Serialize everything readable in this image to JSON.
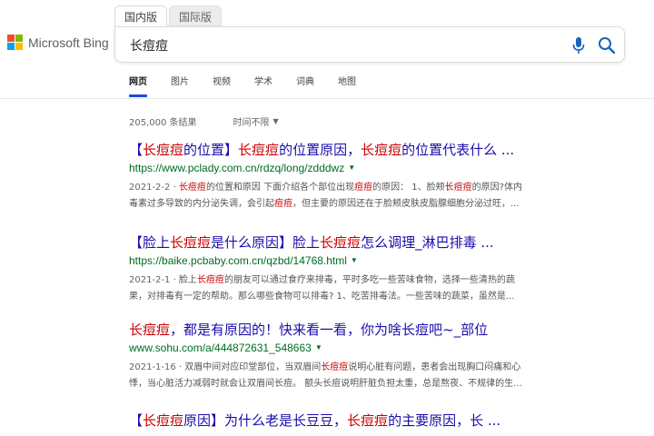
{
  "brand": {
    "logo_text": "Microsoft Bing",
    "logo_colors": [
      "#f25022",
      "#7fba00",
      "#00a4ef",
      "#ffb900"
    ]
  },
  "scope_tabs": [
    {
      "label": "国内版",
      "active": true
    },
    {
      "label": "国际版",
      "active": false
    }
  ],
  "search": {
    "query": "长痘痘",
    "mic_icon": "mic-icon",
    "search_icon": "search-icon"
  },
  "nav": {
    "items": [
      {
        "label": "网页",
        "active": true
      },
      {
        "label": "图片",
        "active": false
      },
      {
        "label": "视频",
        "active": false
      },
      {
        "label": "学术",
        "active": false
      },
      {
        "label": "词典",
        "active": false
      },
      {
        "label": "地图",
        "active": false
      }
    ]
  },
  "meta": {
    "result_count": "205,000 条结果",
    "time_filter": "时间不限"
  },
  "colors": {
    "link": "#1a0dab",
    "highlight": "#c00000",
    "url": "#006d21",
    "nav_active": "#174ae4"
  },
  "results": [
    {
      "title": {
        "p1": "【",
        "h1": "长痘痘",
        "p2": "的位置】",
        "h2": "长痘痘",
        "p3": "的位置原因，",
        "h3": "长痘痘",
        "p4": "的位置代表什么 ..."
      },
      "url": "https://www.pclady.com.cn/rdzq/long/zdddwz",
      "snippet": {
        "date": "2021-2-2",
        "l1a": " · ",
        "l1h1": "长痘痘",
        "l1b": "的位置和原因 下面介绍各个部位出现",
        "l1h2": "痘痘",
        "l1c": "的原因： 1、脸颊",
        "l1h3": "长痘痘",
        "l1d": "的原因?体内",
        "l2a": "毒素过多导致的内分泌失调，会引起",
        "l2h1": "痘痘",
        "l2b": "，但主要的原因还在于脸颊皮肤皮脂腺细胞分泌过旺，..."
      }
    },
    {
      "title": {
        "p1": "【脸上",
        "h1": "长痘痘",
        "p2": "是什么原因】脸上",
        "h2": "长痘痘",
        "p3": "怎么调理_淋巴排毒 ..."
      },
      "url": "https://baike.pcbaby.com.cn/qzbd/14768.html",
      "snippet": {
        "date": "2021-2-1",
        "l1a": " · 脸上",
        "l1h1": "长痘痘",
        "l1b": "的朋友可以通过食疗来排毒，平时多吃一些苦味食物，选择一些清热的蔬",
        "l2a": "果，对排毒有一定的帮助。那么哪些食物可以排毒? 1、吃苦排毒法。一些苦味的蔬菜，虽然是..."
      }
    },
    {
      "title": {
        "h1": "长痘痘",
        "p1": "，都是有原因的！快来看一看，你为啥长痘吧~_部位"
      },
      "url": "www.sohu.com/a/444872631_548663",
      "snippet": {
        "date": "2021-1-16",
        "l1a": " · 双眉中间对应印堂部位，当双眉间",
        "l1h1": "长痘痘",
        "l1b": "说明心脏有问题，患者会出现胸口闷痛和心",
        "l2a": "悸，当心脏活力减弱时就会让双眉间长痘。 额头长痘说明肝脏负担太重，总是熬夜、不规律的生..."
      }
    },
    {
      "title": {
        "p1": "【",
        "h1": "长痘痘",
        "p2": "原因】为什么老是长豆豆，",
        "h2": "长痘痘",
        "p3": "的主要原因，长 ..."
      }
    }
  ]
}
